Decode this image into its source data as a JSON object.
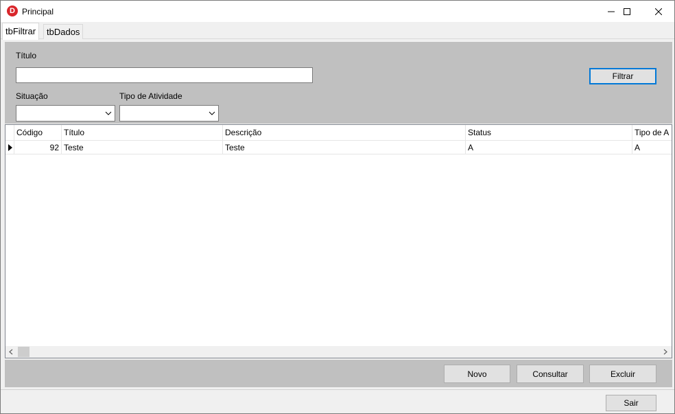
{
  "window": {
    "title": "Principal",
    "icon": "app-logo-d-icon",
    "controls": [
      "minimize-icon",
      "maximize-icon",
      "close-icon"
    ]
  },
  "tabs": [
    {
      "label": "tbFiltrar",
      "active": true
    },
    {
      "label": "tbDados",
      "active": false
    }
  ],
  "filter": {
    "titulo_label": "Título",
    "titulo_value": "",
    "situacao_label": "Situação",
    "situacao_value": "",
    "tipo_label": "Tipo de Atividade",
    "tipo_value": "",
    "filtrar_button": "Filtrar"
  },
  "grid": {
    "columns": [
      "Código",
      "Título",
      "Descrição",
      "Status",
      "Tipo de A"
    ],
    "rows": [
      {
        "codigo": "92",
        "titulo": "Teste",
        "descricao": "Teste",
        "status": "A",
        "tipo": "A"
      }
    ]
  },
  "actions": {
    "novo": "Novo",
    "consultar": "Consultar",
    "excluir": "Excluir"
  },
  "footer": {
    "sair": "Sair"
  }
}
